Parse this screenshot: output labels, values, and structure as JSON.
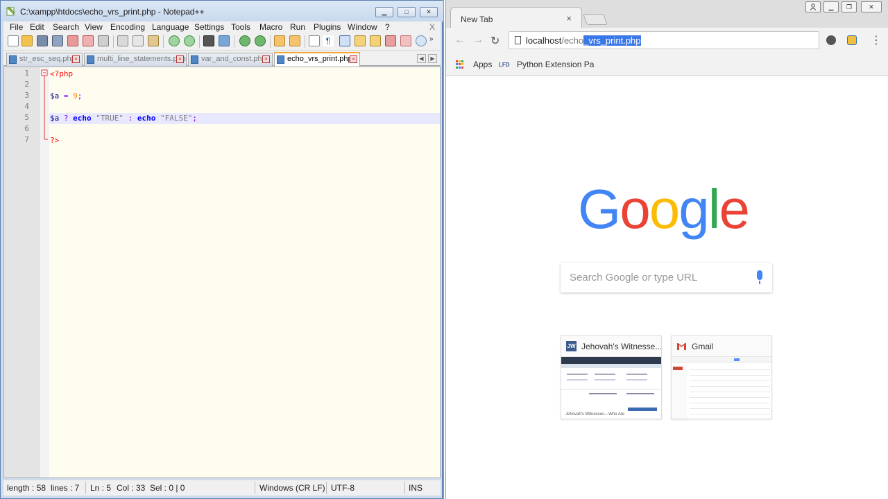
{
  "notepad": {
    "title": "C:\\xampp\\htdocs\\echo_vrs_print.php - Notepad++",
    "window_buttons": {
      "minimize": "▁",
      "maximize": "□",
      "close": "✕"
    },
    "menu": [
      "File",
      "Edit",
      "Search",
      "View",
      "Encoding",
      "Language",
      "Settings",
      "Tools",
      "Macro",
      "Run",
      "Plugins",
      "Window",
      "?"
    ],
    "menu_close": "X",
    "tabs": [
      {
        "label": "str_esc_seq.php",
        "active": false
      },
      {
        "label": "multi_line_statements.php",
        "active": false
      },
      {
        "label": "var_and_const.php",
        "active": false
      },
      {
        "label": "echo_vrs_print.php",
        "active": true
      }
    ],
    "line_numbers": [
      "1",
      "2",
      "3",
      "4",
      "5",
      "6",
      "7"
    ],
    "code": {
      "line1": "<?php",
      "line3_var": "$a",
      "line3_op": " = ",
      "line3_num": "9",
      "line3_end": ";",
      "line5_var": "$a",
      "line5_q": " ? ",
      "line5_echo1": "echo",
      "line5_str1": " \"TRUE\"",
      "line5_colon": " : ",
      "line5_echo2": "echo",
      "line5_str2": " \"FALSE\"",
      "line5_end": ";",
      "line7": "?>"
    },
    "status": {
      "length": "length : 58",
      "lines": "lines : 7",
      "ln": "Ln : 5",
      "col": "Col : 33",
      "sel": "Sel : 0 | 0",
      "eol": "Windows (CR LF)",
      "encoding": "UTF-8",
      "mode": "INS"
    }
  },
  "chrome": {
    "tab_label": "New Tab",
    "tab_close": "×",
    "url": {
      "host": "localhos",
      "cursor": "t",
      "path_dim": "/echo",
      "selected": "_vrs_print.php"
    },
    "bookmarks": {
      "apps": "Apps",
      "lfd_icon_text": "LFD",
      "python": "Python Extension Pa"
    },
    "search_placeholder": "Search Google or type URL",
    "tiles": [
      {
        "icon_text": "JW",
        "label": "Jehovah's Witnesse..."
      },
      {
        "icon_text": "M",
        "label": "Gmail"
      }
    ],
    "jw_thumb_caption": "Jehovah's Witnesses—Who Are"
  }
}
